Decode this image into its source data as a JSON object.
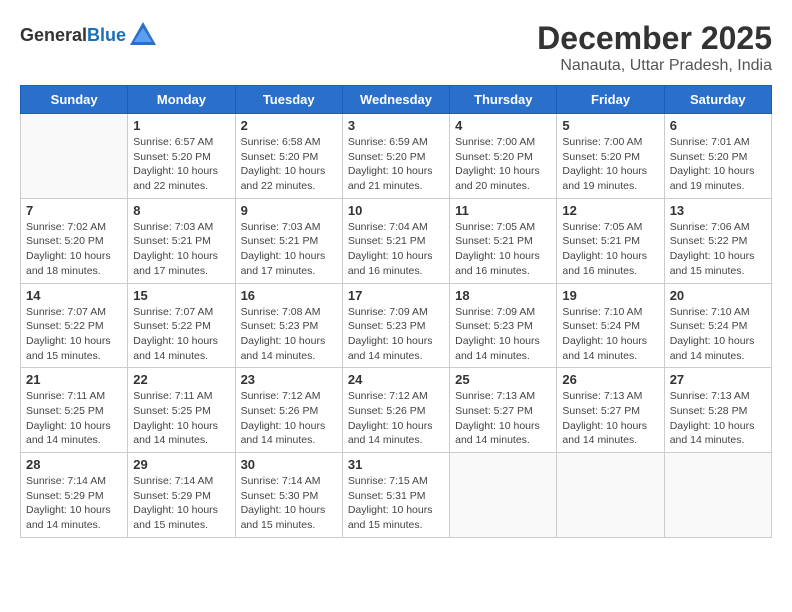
{
  "header": {
    "logo_general": "General",
    "logo_blue": "Blue",
    "month_title": "December 2025",
    "location": "Nanauta, Uttar Pradesh, India"
  },
  "weekdays": [
    "Sunday",
    "Monday",
    "Tuesday",
    "Wednesday",
    "Thursday",
    "Friday",
    "Saturday"
  ],
  "weeks": [
    [
      {
        "day": "",
        "info": ""
      },
      {
        "day": "1",
        "info": "Sunrise: 6:57 AM\nSunset: 5:20 PM\nDaylight: 10 hours\nand 22 minutes."
      },
      {
        "day": "2",
        "info": "Sunrise: 6:58 AM\nSunset: 5:20 PM\nDaylight: 10 hours\nand 22 minutes."
      },
      {
        "day": "3",
        "info": "Sunrise: 6:59 AM\nSunset: 5:20 PM\nDaylight: 10 hours\nand 21 minutes."
      },
      {
        "day": "4",
        "info": "Sunrise: 7:00 AM\nSunset: 5:20 PM\nDaylight: 10 hours\nand 20 minutes."
      },
      {
        "day": "5",
        "info": "Sunrise: 7:00 AM\nSunset: 5:20 PM\nDaylight: 10 hours\nand 19 minutes."
      },
      {
        "day": "6",
        "info": "Sunrise: 7:01 AM\nSunset: 5:20 PM\nDaylight: 10 hours\nand 19 minutes."
      }
    ],
    [
      {
        "day": "7",
        "info": "Sunrise: 7:02 AM\nSunset: 5:20 PM\nDaylight: 10 hours\nand 18 minutes."
      },
      {
        "day": "8",
        "info": "Sunrise: 7:03 AM\nSunset: 5:21 PM\nDaylight: 10 hours\nand 17 minutes."
      },
      {
        "day": "9",
        "info": "Sunrise: 7:03 AM\nSunset: 5:21 PM\nDaylight: 10 hours\nand 17 minutes."
      },
      {
        "day": "10",
        "info": "Sunrise: 7:04 AM\nSunset: 5:21 PM\nDaylight: 10 hours\nand 16 minutes."
      },
      {
        "day": "11",
        "info": "Sunrise: 7:05 AM\nSunset: 5:21 PM\nDaylight: 10 hours\nand 16 minutes."
      },
      {
        "day": "12",
        "info": "Sunrise: 7:05 AM\nSunset: 5:21 PM\nDaylight: 10 hours\nand 16 minutes."
      },
      {
        "day": "13",
        "info": "Sunrise: 7:06 AM\nSunset: 5:22 PM\nDaylight: 10 hours\nand 15 minutes."
      }
    ],
    [
      {
        "day": "14",
        "info": "Sunrise: 7:07 AM\nSunset: 5:22 PM\nDaylight: 10 hours\nand 15 minutes."
      },
      {
        "day": "15",
        "info": "Sunrise: 7:07 AM\nSunset: 5:22 PM\nDaylight: 10 hours\nand 14 minutes."
      },
      {
        "day": "16",
        "info": "Sunrise: 7:08 AM\nSunset: 5:23 PM\nDaylight: 10 hours\nand 14 minutes."
      },
      {
        "day": "17",
        "info": "Sunrise: 7:09 AM\nSunset: 5:23 PM\nDaylight: 10 hours\nand 14 minutes."
      },
      {
        "day": "18",
        "info": "Sunrise: 7:09 AM\nSunset: 5:23 PM\nDaylight: 10 hours\nand 14 minutes."
      },
      {
        "day": "19",
        "info": "Sunrise: 7:10 AM\nSunset: 5:24 PM\nDaylight: 10 hours\nand 14 minutes."
      },
      {
        "day": "20",
        "info": "Sunrise: 7:10 AM\nSunset: 5:24 PM\nDaylight: 10 hours\nand 14 minutes."
      }
    ],
    [
      {
        "day": "21",
        "info": "Sunrise: 7:11 AM\nSunset: 5:25 PM\nDaylight: 10 hours\nand 14 minutes."
      },
      {
        "day": "22",
        "info": "Sunrise: 7:11 AM\nSunset: 5:25 PM\nDaylight: 10 hours\nand 14 minutes."
      },
      {
        "day": "23",
        "info": "Sunrise: 7:12 AM\nSunset: 5:26 PM\nDaylight: 10 hours\nand 14 minutes."
      },
      {
        "day": "24",
        "info": "Sunrise: 7:12 AM\nSunset: 5:26 PM\nDaylight: 10 hours\nand 14 minutes."
      },
      {
        "day": "25",
        "info": "Sunrise: 7:13 AM\nSunset: 5:27 PM\nDaylight: 10 hours\nand 14 minutes."
      },
      {
        "day": "26",
        "info": "Sunrise: 7:13 AM\nSunset: 5:27 PM\nDaylight: 10 hours\nand 14 minutes."
      },
      {
        "day": "27",
        "info": "Sunrise: 7:13 AM\nSunset: 5:28 PM\nDaylight: 10 hours\nand 14 minutes."
      }
    ],
    [
      {
        "day": "28",
        "info": "Sunrise: 7:14 AM\nSunset: 5:29 PM\nDaylight: 10 hours\nand 14 minutes."
      },
      {
        "day": "29",
        "info": "Sunrise: 7:14 AM\nSunset: 5:29 PM\nDaylight: 10 hours\nand 15 minutes."
      },
      {
        "day": "30",
        "info": "Sunrise: 7:14 AM\nSunset: 5:30 PM\nDaylight: 10 hours\nand 15 minutes."
      },
      {
        "day": "31",
        "info": "Sunrise: 7:15 AM\nSunset: 5:31 PM\nDaylight: 10 hours\nand 15 minutes."
      },
      {
        "day": "",
        "info": ""
      },
      {
        "day": "",
        "info": ""
      },
      {
        "day": "",
        "info": ""
      }
    ]
  ]
}
